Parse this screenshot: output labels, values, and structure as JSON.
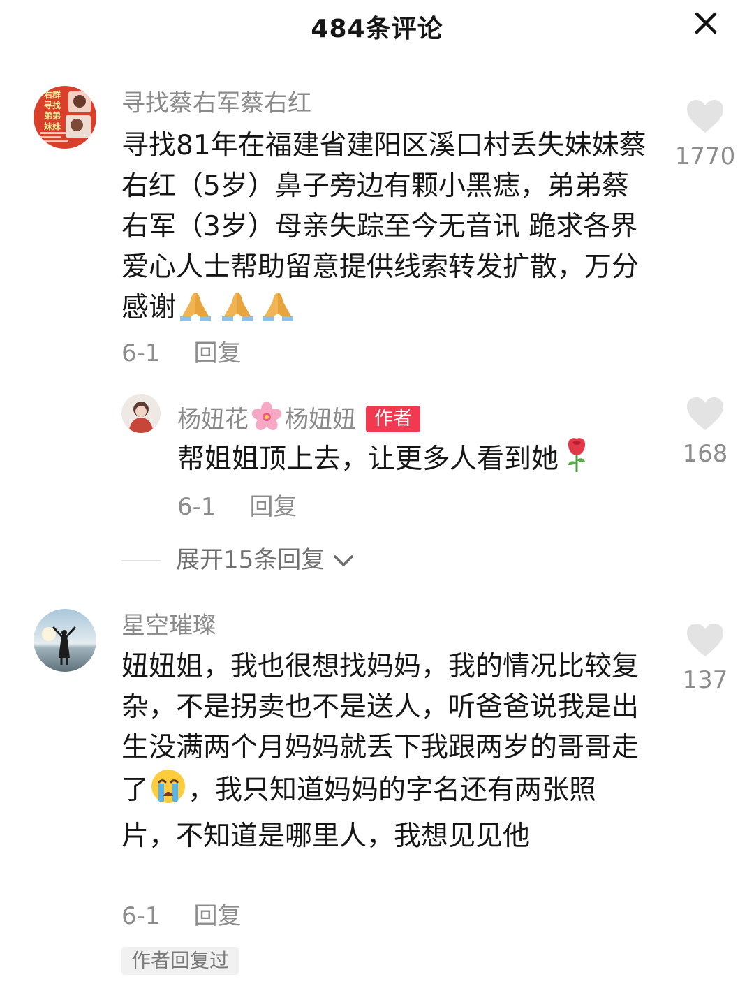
{
  "header": {
    "title": "484条评论",
    "close_icon": "close-icon"
  },
  "comments": [
    {
      "username": "寻找蔡右军蔡右红",
      "avatar_lines": [
        "右群",
        "寻找",
        "弟弟",
        "妹妹"
      ],
      "text": "寻找81年在福建省建阳区溪口村丢失妹妹蔡右红（5岁）鼻子旁边有颗小黑痣，弟弟蔡右军（3岁）母亲失踪至今无音讯 跪求各界爱心人士帮助留意提供线索转发扩散，万分感谢",
      "trailing_emoji": "folded-hands-emoji",
      "date": "6-1",
      "reply_label": "回复",
      "likes": "1770"
    },
    {
      "username": "杨妞花",
      "username_emoji": "cherry-blossom-emoji",
      "username_suffix": "杨妞妞",
      "badge": "作者",
      "text": "帮姐姐顶上去，让更多人看到她",
      "trailing_emoji": "rose-emoji",
      "date": "6-1",
      "reply_label": "回复",
      "likes": "168"
    },
    {
      "username": "星空璀璨",
      "text_part1": "妞妞姐，我也很想找妈妈，我的情况比较复杂，不是拐卖也不是送人，听爸爸说我是出生没满两个月妈妈就丢下我跟两岁的哥哥走了",
      "inline_emoji": "crying-face-emoji",
      "text_part2": "，我只知道妈妈的字名还有两张照片，不知道是哪里人，我想见见他",
      "date": "6-1",
      "reply_label": "回复",
      "likes": "137",
      "replied_tag": "作者回复过"
    }
  ],
  "expand_replies": {
    "label": "展开15条回复",
    "icon": "chevron-down-icon"
  },
  "colors": {
    "badge": "#f03a52",
    "meta_text": "#8c8c8c",
    "heart": "#e3e3e3",
    "avatar1_bg": "#d8402c"
  }
}
